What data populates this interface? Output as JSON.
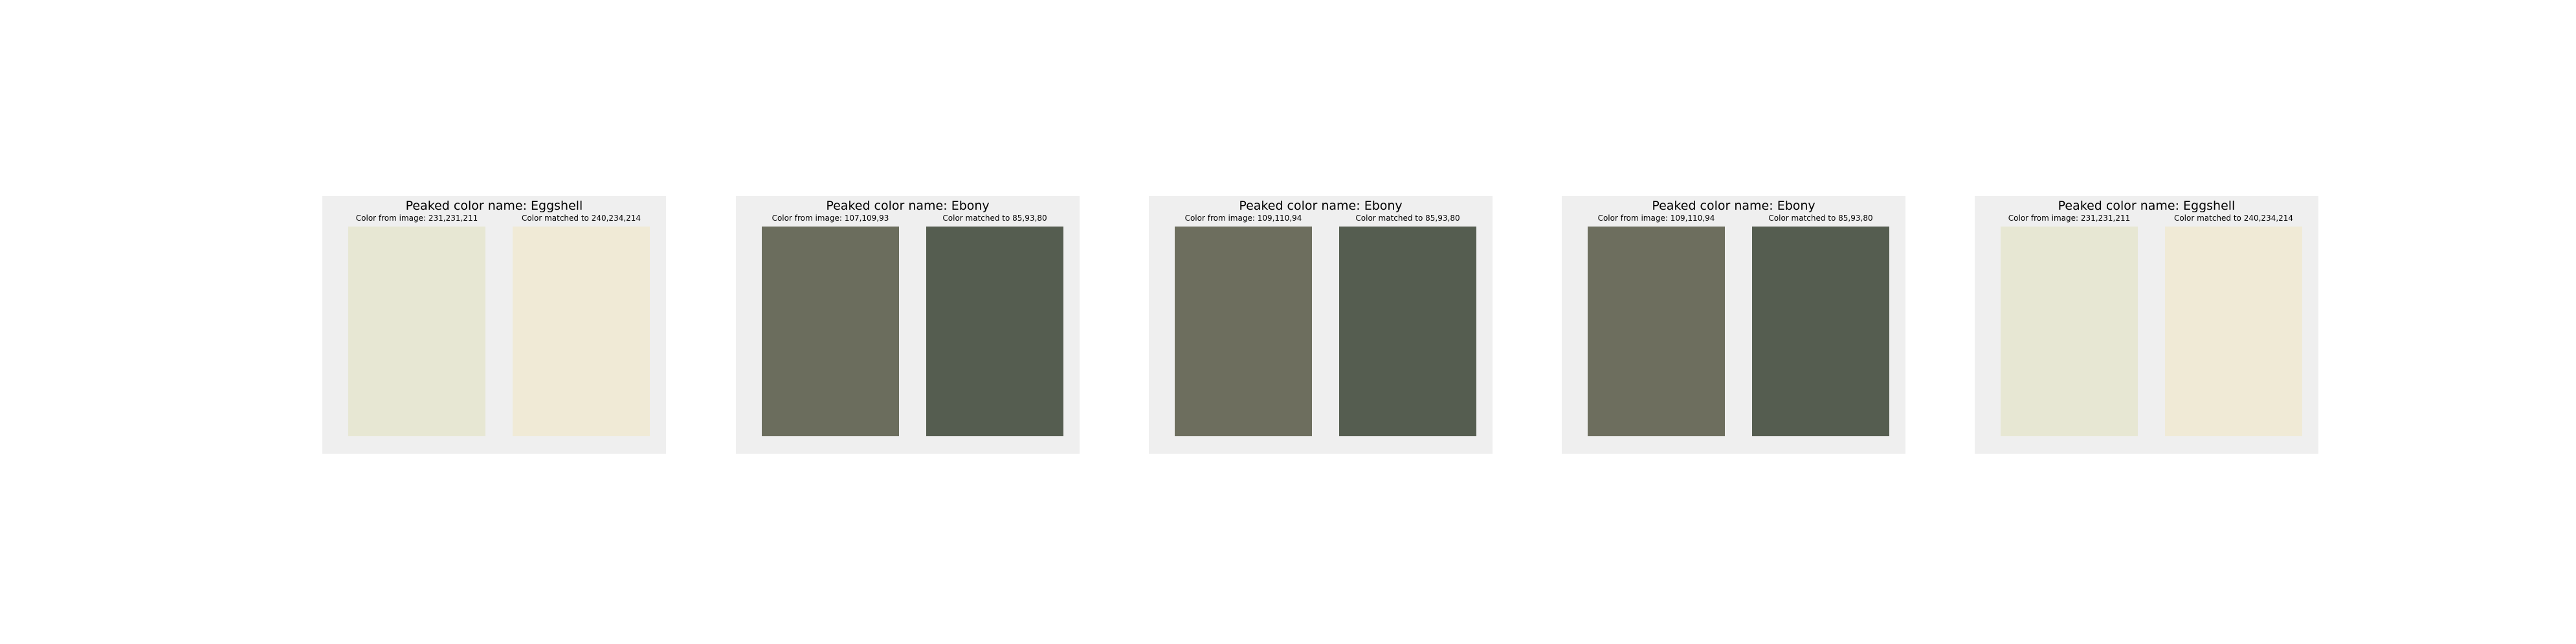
{
  "chart_data": [
    {
      "type": "color-swatch",
      "title": "Peaked color name: Eggshell",
      "left_label": "Color from image: 231,231,211",
      "right_label": "Color matched to 240,234,214",
      "left_rgb": [
        231,
        231,
        211
      ],
      "right_rgb": [
        240,
        234,
        214
      ]
    },
    {
      "type": "color-swatch",
      "title": "Peaked color name: Ebony",
      "left_label": "Color from image: 107,109,93",
      "right_label": "Color matched to 85,93,80",
      "left_rgb": [
        107,
        109,
        93
      ],
      "right_rgb": [
        85,
        93,
        80
      ]
    },
    {
      "type": "color-swatch",
      "title": "Peaked color name: Ebony",
      "left_label": "Color from image: 109,110,94",
      "right_label": "Color matched to 85,93,80",
      "left_rgb": [
        109,
        110,
        94
      ],
      "right_rgb": [
        85,
        93,
        80
      ]
    },
    {
      "type": "color-swatch",
      "title": "Peaked color name: Ebony",
      "left_label": "Color from image: 109,110,94",
      "right_label": "Color matched to 85,93,80",
      "left_rgb": [
        109,
        110,
        94
      ],
      "right_rgb": [
        85,
        93,
        80
      ]
    },
    {
      "type": "color-swatch",
      "title": "Peaked color name: Eggshell",
      "left_label": "Color from image: 231,231,211",
      "right_label": "Color matched to 240,234,214",
      "left_rgb": [
        231,
        231,
        211
      ],
      "right_rgb": [
        240,
        234,
        214
      ]
    }
  ]
}
